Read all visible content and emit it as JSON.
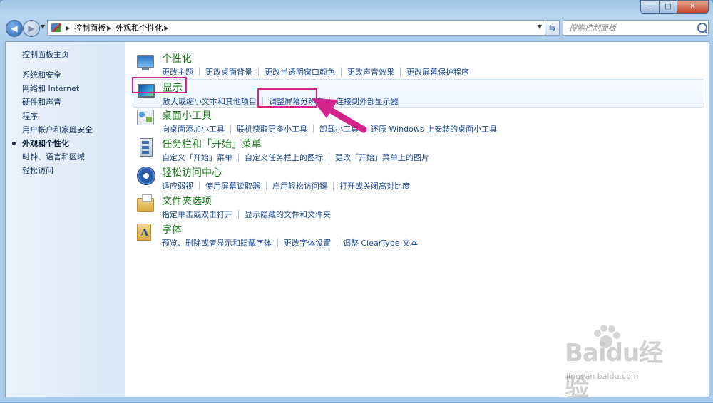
{
  "window": {
    "controls": {
      "minimize": "─",
      "maximize": "□",
      "close": "✕"
    }
  },
  "address": {
    "breadcrumbs": [
      "控制面板",
      "外观和个性化"
    ],
    "search_placeholder": "搜索控制面板"
  },
  "sidebar": {
    "home": "控制面板主页",
    "items": [
      {
        "label": "系统和安全",
        "active": false
      },
      {
        "label": "网络和 Internet",
        "active": false
      },
      {
        "label": "硬件和声音",
        "active": false
      },
      {
        "label": "程序",
        "active": false
      },
      {
        "label": "用户帐户和家庭安全",
        "active": false
      },
      {
        "label": "外观和个性化",
        "active": true
      },
      {
        "label": "时钟、语言和区域",
        "active": false
      },
      {
        "label": "轻松访问",
        "active": false
      }
    ]
  },
  "categories": [
    {
      "icon": "personalization-icon",
      "title": "个性化",
      "links": [
        "更改主题",
        "更改桌面背景",
        "更改半透明窗口颜色",
        "更改声音效果",
        "更改屏幕保护程序"
      ]
    },
    {
      "icon": "display-icon",
      "title": "显示",
      "links": [
        "放大或缩小文本和其他项目",
        "调整屏幕分辨率",
        "连接到外部显示器"
      ]
    },
    {
      "icon": "desktop-gadgets-icon",
      "title": "桌面小工具",
      "links": [
        "向桌面添加小工具",
        "联机获取更多小工具",
        "卸载小工具",
        "还原 Windows 上安装的桌面小工具"
      ]
    },
    {
      "icon": "taskbar-icon",
      "title": "任务栏和「开始」菜单",
      "links": [
        "自定义「开始」菜单",
        "自定义任务栏上的图标",
        "更改「开始」菜单上的图片"
      ]
    },
    {
      "icon": "ease-of-access-icon",
      "title": "轻松访问中心",
      "links": [
        "适应弱视",
        "使用屏幕读取器",
        "启用轻松访问键",
        "打开或关闭高对比度"
      ]
    },
    {
      "icon": "folder-options-icon",
      "title": "文件夹选项",
      "links": [
        "指定单击或双击打开",
        "显示隐藏的文件和文件夹"
      ]
    },
    {
      "icon": "fonts-icon",
      "title": "字体",
      "links": [
        "预览、删除或者显示和隐藏字体",
        "更改字体设置",
        "调整 ClearType 文本"
      ]
    }
  ],
  "watermark": {
    "logo": "Baidu经验",
    "url": "jingyan.baidu.com"
  },
  "colors": {
    "annotation": "#d4238a",
    "link": "#1c4a94",
    "category_title": "#1a7a1a"
  }
}
